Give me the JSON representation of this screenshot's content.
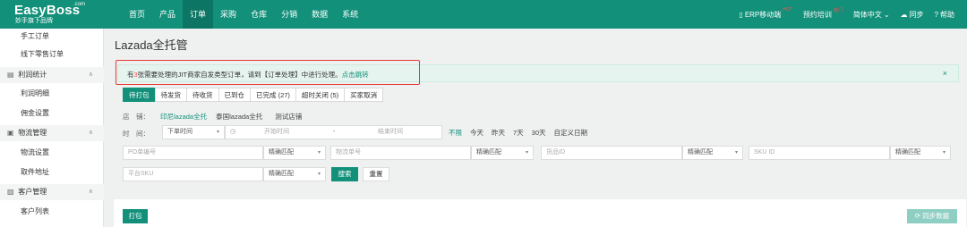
{
  "brand": {
    "name": "EasyBoss",
    "com": ".com",
    "slogan": "妙手旗下品牌"
  },
  "nav": [
    "首页",
    "产品",
    "订单",
    "采购",
    "仓库",
    "分销",
    "数据",
    "系统"
  ],
  "topright": {
    "erp_mobile": "ERP移动端",
    "hot1": "HOT",
    "training": "预约培训",
    "hot2": "热门",
    "language": "简体中文",
    "sync": "同步",
    "help": "帮助"
  },
  "sidebar": {
    "manual_order": "手工订单",
    "offline_order": "线下零售订单",
    "profit_group": "利润统计",
    "profit_detail": "利润明细",
    "commission": "佣金设置",
    "logistics_group": "物流管理",
    "logistics_settings": "物流设置",
    "pickup": "取件地址",
    "customer_group": "客户管理",
    "customer_list": "客户列表"
  },
  "page_title": "Lazada全托管",
  "notice": {
    "prefix": "有",
    "count": "3",
    "middle": "张需要处理的JIT商家自发类型订单，请到【订单处理】中进行处理。",
    "link": "点击跳转",
    "close": "×"
  },
  "tabs": [
    "待打包",
    "待发货",
    "待收货",
    "已到仓",
    "已完成 (27)",
    "超时关闭 (5)",
    "买家取消"
  ],
  "filters": {
    "store_label": "店　铺：",
    "stores": [
      "印尼lazada全托",
      "泰国lazada全托",
      "测试店铺"
    ],
    "time_label": "时　间：",
    "time_type": "下单时间",
    "start_placeholder": "开始时间",
    "dash": "-",
    "end_placeholder": "结束时间",
    "quick": [
      "不限",
      "今天",
      "昨天",
      "7天",
      "30天",
      "自定义日期"
    ]
  },
  "search_fields": [
    {
      "placeholder": "PO单编号",
      "match": "精确匹配"
    },
    {
      "placeholder": "物流单号",
      "match": "精确匹配"
    },
    {
      "placeholder": "货品ID",
      "match": "精确匹配"
    },
    {
      "placeholder": "SKU ID",
      "match": "精确匹配"
    },
    {
      "placeholder": "平台SKU",
      "match": "精确匹配"
    }
  ],
  "buttons": {
    "search": "搜索",
    "reset": "重置",
    "print": "打包",
    "sync_data": "同步数据"
  },
  "colors": {
    "primary": "#12907a",
    "nav_active": "#0c7563",
    "alert_red": "#e53935",
    "notice_bg": "#e5f4ee"
  }
}
